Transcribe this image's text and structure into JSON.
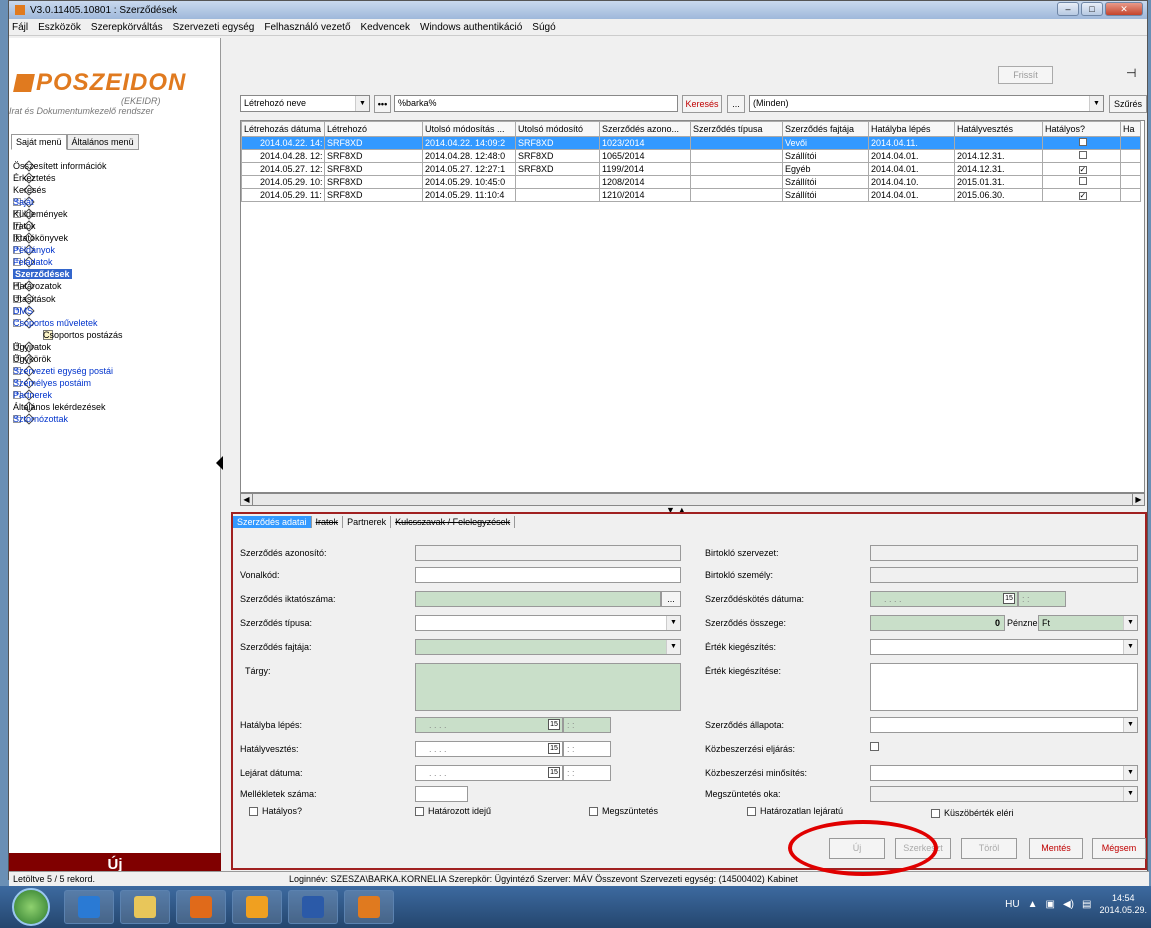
{
  "window": {
    "title": "V3.0.11405.10801 : Szerződések",
    "buttons": [
      "–",
      "□",
      "✕"
    ]
  },
  "menu": [
    "Fájl",
    "Eszközök",
    "Szerepkörváltás",
    "Szervezeti egység",
    "Felhasználó vezető",
    "Kedvencek",
    "Windows authentikáció",
    "Súgó"
  ],
  "logo": {
    "name": "POSZEIDON",
    "sub1": "(EKEIDR)",
    "sub2": "Irat és Dokumentumkezelő rendszer"
  },
  "left_tabs": [
    "Saját menü",
    "Általános menü"
  ],
  "tree": [
    {
      "label": "Összesített információk",
      "expandable": false,
      "blue": false
    },
    {
      "label": "Érkeztetés",
      "expandable": false,
      "blue": false
    },
    {
      "label": "Keresés",
      "expandable": false,
      "blue": false
    },
    {
      "label": "Saját",
      "expandable": true,
      "blue": true
    },
    {
      "label": "Küldemények",
      "expandable": true,
      "blue": false
    },
    {
      "label": "Iratok",
      "expandable": true,
      "blue": false
    },
    {
      "label": "Iktatókönyvek",
      "expandable": true,
      "blue": false
    },
    {
      "label": "Példányok",
      "expandable": true,
      "blue": true
    },
    {
      "label": "Feladatok",
      "expandable": true,
      "blue": true
    },
    {
      "label": "Szerződések",
      "expandable": true,
      "blue": false,
      "selected": true
    },
    {
      "label": "Határozatok",
      "expandable": true,
      "blue": false
    },
    {
      "label": "Utasítások",
      "expandable": true,
      "blue": false
    },
    {
      "label": "DMS",
      "expandable": true,
      "blue": true
    },
    {
      "label": "Csoportos műveletek",
      "expandable": true,
      "blue": true,
      "expanded": true
    },
    {
      "label": "Csoportos postázás",
      "child": true
    },
    {
      "label": "Ügyiratok",
      "expandable": true,
      "blue": false
    },
    {
      "label": "Ügykörök",
      "expandable": true,
      "blue": false
    },
    {
      "label": "Szervezeti egység postái",
      "expandable": true,
      "blue": true
    },
    {
      "label": "Személyes postáim",
      "expandable": true,
      "blue": true
    },
    {
      "label": "Partnerek",
      "expandable": true,
      "blue": true
    },
    {
      "label": "Általános lekérdezések",
      "expandable": false,
      "blue": false
    },
    {
      "label": "Sztornózottak",
      "expandable": true,
      "blue": true
    }
  ],
  "new_label": "Új",
  "toolbar": {
    "refresh": "Frissít"
  },
  "filter": {
    "field": "Létrehozó neve",
    "value": "%barka%",
    "search": "Keresés",
    "dots": "...",
    "scope": "(Minden)",
    "filter_btn": "Szűrés"
  },
  "grid": {
    "columns": [
      "Létrehozás dátuma",
      "Létrehozó",
      "Utolsó módosítás ...",
      "Utolsó módosító",
      "Szerződés azono...",
      "Szerződés típusa",
      "Szerződés fajtája",
      "Hatályba lépés",
      "Hatályvesztés",
      "Hatályos?",
      "Ha"
    ],
    "rows": [
      {
        "created": "2014.04.22. 14:",
        "creator": "SRF8XD",
        "modified": "2014.04.22. 14:09:2",
        "modifier": "SRF8XD",
        "id": "1023/2014",
        "type": "",
        "kind": "Vevői",
        "start": "2014.04.11.",
        "end": "",
        "valid": false,
        "selected": true
      },
      {
        "created": "2014.04.28. 12:",
        "creator": "SRF8XD",
        "modified": "2014.04.28. 12:48:0",
        "modifier": "SRF8XD",
        "id": "1065/2014",
        "type": "",
        "kind": "Szállítói",
        "start": "2014.04.01.",
        "end": "2014.12.31.",
        "valid": false
      },
      {
        "created": "2014.05.27. 12:",
        "creator": "SRF8XD",
        "modified": "2014.05.27. 12:27:1",
        "modifier": "SRF8XD",
        "id": "1199/2014",
        "type": "",
        "kind": "Egyéb",
        "start": "2014.04.01.",
        "end": "2014.12.31.",
        "valid": true
      },
      {
        "created": "2014.05.29. 10:",
        "creator": "SRF8XD",
        "modified": "2014.05.29. 10:45:0",
        "modifier": "",
        "id": "1208/2014",
        "type": "",
        "kind": "Szállítói",
        "start": "2014.04.10.",
        "end": "2015.01.31.",
        "valid": false
      },
      {
        "created": "2014.05.29. 11:",
        "creator": "SRF8XD",
        "modified": "2014.05.29. 11:10:4",
        "modifier": "",
        "id": "1210/2014",
        "type": "",
        "kind": "Szállítói",
        "start": "2014.04.01.",
        "end": "2015.06.30.",
        "valid": true
      }
    ]
  },
  "detail_tabs": [
    "Szerződés adatai",
    "Iratok",
    "Partnerek",
    "Kulcsszavak / Felelegyzések"
  ],
  "form": {
    "left": {
      "azonosito": "Szerződés azonosító:",
      "vonalkod": "Vonalkód:",
      "iktatoszam": "Szerződés iktatószáma:",
      "tipusa": "Szerződés típusa:",
      "fajtaja": "Szerződés fajtája:",
      "targy": "Tárgy:",
      "hatalyba": "Hatályba lépés:",
      "hatalyvesztes": "Hatályvesztés:",
      "lejarat": "Lejárat dátuma:",
      "mellekletek": "Mellékletek száma:",
      "date_placeholder": ". . . .",
      "time_placeholder": ": :",
      "cal_label": "15"
    },
    "right": {
      "birtoklo_szervezet": "Birtokló szervezet:",
      "birtoklo_szemely": "Birtokló személy:",
      "kotes_datuma": "Szerződéskötés dátuma:",
      "osszege": "Szerződés összege:",
      "osszeg_value": "0",
      "penznem_label": "Pénznem:",
      "penznem_value": "Ft",
      "ertek_kieg_1": "Érték kiegészítés:",
      "ertek_kieg_2": "Érték kiegészítése:",
      "allapota": "Szerződés állapota:",
      "kozbeszerzesi_eljaras": "Közbeszerzési eljárás:",
      "kozbeszerzesi_minosites": "Közbeszerzési minősítés:",
      "megszuntetes_oka": "Megszüntetés oka:"
    },
    "checkboxes": [
      "Hatályos?",
      "Határozott idejű",
      "Megszüntetés",
      "Határozatlan lejáratú",
      "Küszöbérték eléri"
    ]
  },
  "actions": {
    "new": "Új",
    "edit": "Szerkeszt",
    "delete": "Töröl",
    "save": "Mentés",
    "cancel": "Mégsem"
  },
  "status": {
    "records": "Letöltve 5 / 5 rekord.",
    "info": "Loginnév: SZESZA\\BARKA.KORNELIA   Szerepkör: Ügyintéző   Szerver: MÁV Összevont   Szervezeti egység: (14500402) Kabinet"
  },
  "taskbar": {
    "lang": "HU",
    "time": "14:54",
    "date": "2014.05.29."
  }
}
